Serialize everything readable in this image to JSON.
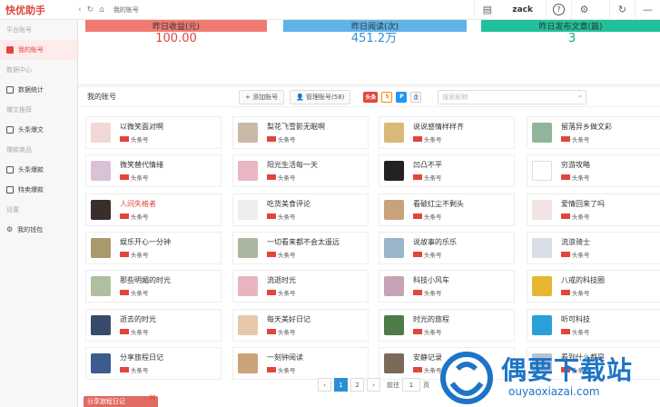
{
  "app": {
    "brand": "快优助手",
    "breadcrumb": "我的账号",
    "user": "zack",
    "nav": {
      "back": "‹",
      "forward": "›",
      "refresh": "↻",
      "home": "⌂"
    }
  },
  "sidebar": {
    "groups": [
      {
        "label": "平台账号",
        "items": [
          {
            "label": "我的账号",
            "active": true
          }
        ]
      },
      {
        "label": "数据中心",
        "items": [
          {
            "label": "数据统计",
            "active": false
          }
        ]
      },
      {
        "label": "爆文推荐",
        "items": [
          {
            "label": "头条爆文",
            "active": false
          }
        ]
      },
      {
        "label": "爆款商品",
        "items": [
          {
            "label": "头条爆款",
            "active": false
          },
          {
            "label": "特卖爆款",
            "active": false
          }
        ]
      },
      {
        "label": "设置",
        "items": [
          {
            "label": "我的钱包",
            "active": false
          }
        ]
      }
    ]
  },
  "stats": [
    {
      "value": "100.00",
      "label": "昨日收益(元)",
      "color": "#ef7a72",
      "text_color": "#e2453c"
    },
    {
      "value": "451.2万",
      "label": "昨日阅读(次)",
      "color": "#5eb3e8",
      "text_color": "#2b8fd8"
    },
    {
      "value": "3",
      "label": "昨日发布文章(篇)",
      "color": "#20c09a",
      "text_color": "#13b088"
    }
  ],
  "panel": {
    "title": "我的账号",
    "add_label": "添加账号",
    "manage_label": "管理账号(58)",
    "search_placeholder": "搜索昵称",
    "platforms": [
      {
        "text": "头条",
        "color": "#e2453c"
      },
      {
        "text": "5",
        "color": "#ff8a00"
      },
      {
        "text": "P",
        "color": "#2196f3"
      },
      {
        "text": "企",
        "color": "#3f6fb4"
      }
    ]
  },
  "accounts": [
    {
      "name": "以微笑面对啊",
      "tag": "头条号",
      "avatar": "#f2d7d7"
    },
    {
      "name": "梨花飞雪影无眠啊",
      "tag": "头条号",
      "avatar": "#c9b9a8"
    },
    {
      "name": "说说感情样样齐",
      "tag": "头条号",
      "avatar": "#d8b978"
    },
    {
      "name": "留落异乡做文彩",
      "tag": "头条号",
      "avatar": "#8fb59a"
    },
    {
      "name": "微笑替代情绪",
      "tag": "头条号",
      "avatar": "#d9c1d6"
    },
    {
      "name": "阳光生活每一天",
      "tag": "头条号",
      "avatar": "#e9b6c4"
    },
    {
      "name": "凹凸不平",
      "tag": "头条号",
      "avatar": "#222222"
    },
    {
      "name": "穷游攻略",
      "tag": "头条号",
      "avatar": "#ffffff"
    },
    {
      "name": "人间失格者",
      "tag": "头条号",
      "avatar": "#3a2e2a",
      "highlight": true
    },
    {
      "name": "吃货美食评论",
      "tag": "头条号",
      "avatar": "#eeeeee"
    },
    {
      "name": "看破红尘不剩头",
      "tag": "头条号",
      "avatar": "#c8a37a"
    },
    {
      "name": "爱情回来了吗",
      "tag": "头条号",
      "avatar": "#f3e4e4"
    },
    {
      "name": "娱乐开心一分钟",
      "tag": "头条号",
      "avatar": "#a89a6a"
    },
    {
      "name": "一切看来都不会太遥远",
      "tag": "头条号",
      "avatar": "#a9b6a0"
    },
    {
      "name": "说故事的乐乐",
      "tag": "头条号",
      "avatar": "#9ab4c8"
    },
    {
      "name": "流浪骑士",
      "tag": "头条号",
      "avatar": "#d9dde8"
    },
    {
      "name": "那些明媚的时光",
      "tag": "头条号",
      "avatar": "#b0bfa0"
    },
    {
      "name": "流逝时光",
      "tag": "头条号",
      "avatar": "#e7b4c0"
    },
    {
      "name": "科技小风车",
      "tag": "头条号",
      "avatar": "#c7a3b8"
    },
    {
      "name": "八戒的科技圈",
      "tag": "头条号",
      "avatar": "#e8b630"
    },
    {
      "name": "逝去的时光",
      "tag": "头条号",
      "avatar": "#3a4a6a"
    },
    {
      "name": "每天美好日记",
      "tag": "头条号",
      "avatar": "#e6c9a8"
    },
    {
      "name": "时光的旅程",
      "tag": "头条号",
      "avatar": "#4f7a4a"
    },
    {
      "name": "听可科技",
      "tag": "头条号",
      "avatar": "#2aa0d8"
    },
    {
      "name": "分享旅程日记",
      "tag": "头条号",
      "avatar": "#3b5c8c"
    },
    {
      "name": "一刻钟阅读",
      "tag": "头条号",
      "avatar": "#c9a37a"
    },
    {
      "name": "安静记录",
      "tag": "头条号",
      "avatar": "#7a6a5a"
    },
    {
      "name": "看到什么都是",
      "tag": "头条号",
      "avatar": "#b9c4cf"
    }
  ],
  "pager": {
    "prev": "‹",
    "pages": [
      "1",
      "2"
    ],
    "current": "1",
    "next": "›",
    "goto_label": "前往",
    "goto_value": "1",
    "page_suffix": "页"
  },
  "bottom_tab": {
    "label": "分享旅程日记"
  },
  "watermark": {
    "text": "偶要下载站",
    "sub": "ouyaoxiazai.com"
  }
}
